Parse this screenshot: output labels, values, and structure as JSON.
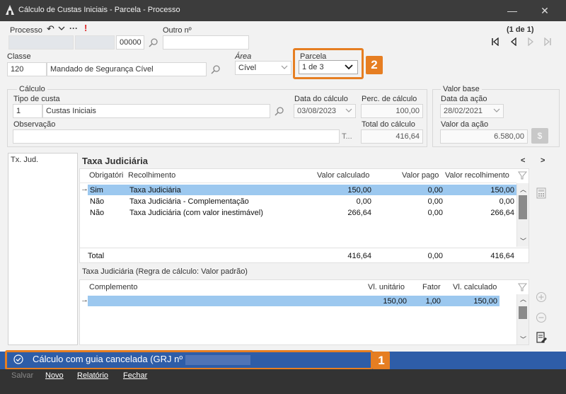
{
  "window": {
    "title": "Cálculo de Custas Iniciais - Parcela - Processo",
    "minimize": "—",
    "close": "✕"
  },
  "processo": {
    "label": "Processo",
    "number_suffix": "00000",
    "more": "···",
    "alert": "!"
  },
  "outro_numero": {
    "label": "Outro nº",
    "value": ""
  },
  "pager": {
    "text": "(1 de 1)"
  },
  "classe": {
    "label": "Classe",
    "code": "120",
    "name": "Mandado de Segurança Cível"
  },
  "area": {
    "label": "Área",
    "value": "Cível"
  },
  "parcela": {
    "label": "Parcela",
    "value": "1 de 3",
    "badge": "2"
  },
  "calculo": {
    "group_label": "Cálculo",
    "tipo_custa_label": "Tipo de custa",
    "tipo_custa_code": "1",
    "tipo_custa_name": "Custas Iniciais",
    "data_calculo_label": "Data do cálculo",
    "data_calculo": "03/08/2023",
    "perc_calculo_label": "Perc. de cálculo",
    "perc_calculo": "100,00",
    "observacao_label": "Observação",
    "observacao": "",
    "total_label": "Total do cálculo",
    "total": "416,64",
    "text_tool": "T..."
  },
  "valor_base": {
    "group_label": "Valor base",
    "data_acao_label": "Data da ação",
    "data_acao": "28/02/2021",
    "valor_acao_label": "Valor da ação",
    "valor_acao": "6.580,00"
  },
  "left_list": {
    "items": [
      "Tx. Jud."
    ]
  },
  "taxa": {
    "title": "Taxa Judiciária",
    "prev": "<",
    "next": ">",
    "columns": [
      "Obrigatóri",
      "Recolhimento",
      "Valor calculado",
      "Valor pago",
      "Valor recolhimento"
    ],
    "rows": [
      {
        "obrig": "Sim",
        "recolhimento": "Taxa Judiciária",
        "calc": "150,00",
        "pago": "0,00",
        "recol": "150,00"
      },
      {
        "obrig": "Não",
        "recolhimento": "Taxa Judiciária - Complementação",
        "calc": "0,00",
        "pago": "0,00",
        "recol": "0,00"
      },
      {
        "obrig": "Não",
        "recolhimento": "Taxa Judiciária (com valor inestimável)",
        "calc": "266,64",
        "pago": "0,00",
        "recol": "266,64"
      }
    ],
    "total_label": "Total",
    "total_calc": "416,64",
    "total_pago": "0,00",
    "total_recol": "416,64"
  },
  "regra": {
    "title": "Taxa Judiciária (Regra de cálculo: Valor padrão)",
    "columns": [
      "Complemento",
      "Vl. unitário",
      "Fator",
      "Vl. calculado"
    ],
    "rows": [
      {
        "complemento": "",
        "unitario": "150,00",
        "fator": "1,00",
        "calculado": "150,00"
      }
    ]
  },
  "status": {
    "text": "Cálculo com guia cancelada (GRJ nº",
    "badge": "1"
  },
  "footer": {
    "salvar": "Salvar",
    "novo": "Novo",
    "relatorio": "Relatório",
    "fechar": "Fechar"
  },
  "colors": {
    "titlebar": "#3c3c3c",
    "status": "#2e5da8",
    "footer": "#333333",
    "highlight": "#e67e22",
    "selection": "#9cc8ef"
  }
}
